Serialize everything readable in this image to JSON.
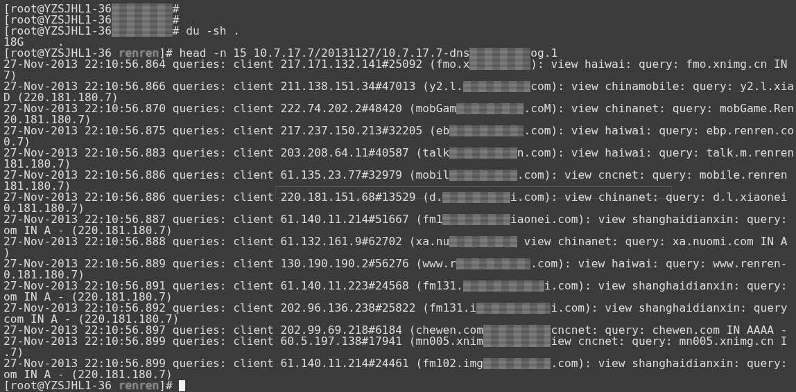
{
  "terminal": {
    "lines": [
      {
        "segments": [
          {
            "kind": "text",
            "text": "[root@YZSJHL1-36"
          },
          {
            "kind": "redacted"
          },
          {
            "kind": "text",
            "text": "#"
          }
        ]
      },
      {
        "segments": [
          {
            "kind": "text",
            "text": "[root@YZSJHL1-36"
          },
          {
            "kind": "redacted"
          },
          {
            "kind": "text",
            "text": "#"
          }
        ]
      },
      {
        "segments": [
          {
            "kind": "text",
            "text": "[root@YZSJHL1-36"
          },
          {
            "kind": "redacted"
          },
          {
            "kind": "text",
            "text": "# du -sh ."
          }
        ]
      },
      {
        "segments": [
          {
            "kind": "text",
            "text": "18G     ."
          }
        ]
      },
      {
        "segments": [
          {
            "kind": "text",
            "text": "[root@YZSJHL1-36 "
          },
          {
            "kind": "smudged",
            "text": "renren"
          },
          {
            "kind": "text",
            "text": "]# head -n 15 10.7.17.7/20131127/10.7.17.7-dns"
          },
          {
            "kind": "redacted"
          },
          {
            "kind": "text",
            "text": "og.1"
          }
        ]
      },
      {
        "segments": [
          {
            "kind": "text",
            "text": "27-Nov-2013 22:10:56.864 queries: client 217.171.132.141#25092 (fmo.x"
          },
          {
            "kind": "redacted"
          },
          {
            "kind": "text",
            "text": "): view haiwai: query: fmo.xnimg.cn IN"
          }
        ]
      },
      {
        "segments": [
          {
            "kind": "text",
            "text": "7)"
          }
        ]
      },
      {
        "segments": [
          {
            "kind": "text",
            "text": "27-Nov-2013 22:10:56.866 queries: client 211.138.151.34#47013 (y2.l."
          },
          {
            "kind": "redacted"
          },
          {
            "kind": "text",
            "text": "com): view chinamobile: query: y2.l.xia"
          }
        ]
      },
      {
        "segments": [
          {
            "kind": "text",
            "text": "D (220.181.180.7)"
          }
        ]
      },
      {
        "segments": [
          {
            "kind": "text",
            "text": "27-Nov-2013 22:10:56.870 queries: client 222.74.202.2#48420 (mobGam"
          },
          {
            "kind": "redacted"
          },
          {
            "kind": "text",
            "text": ".coM): view chinanet: query: mobGame.Ren"
          }
        ]
      },
      {
        "segments": [
          {
            "kind": "text",
            "text": "20.181.180.7)"
          }
        ]
      },
      {
        "segments": [
          {
            "kind": "text",
            "text": "27-Nov-2013 22:10:56.875 queries: client 217.237.150.213#32205 (eb"
          },
          {
            "kind": "redacted"
          },
          {
            "kind": "text",
            "text": ".com): view haiwai: query: ebp.renren.co"
          }
        ]
      },
      {
        "segments": [
          {
            "kind": "text",
            "text": "0.7)"
          }
        ]
      },
      {
        "segments": [
          {
            "kind": "text",
            "text": "27-Nov-2013 22:10:56.883 queries: client 203.208.64.11#40587 (talk"
          },
          {
            "kind": "redacted"
          },
          {
            "kind": "text",
            "text": "n.com): view haiwai: query: talk.m.renren"
          }
        ]
      },
      {
        "segments": [
          {
            "kind": "text",
            "text": "181.180.7)"
          }
        ]
      },
      {
        "segments": [
          {
            "kind": "text",
            "text": "27-Nov-2013 22:10:56.886 queries: client 61.135.23.77#32979 (mobil"
          },
          {
            "kind": "redacted"
          },
          {
            "kind": "text",
            "text": ".com): view cncnet: query: mobile.renren"
          }
        ]
      },
      {
        "segments": [
          {
            "kind": "text",
            "text": "181.180.7)"
          }
        ]
      },
      {
        "segments": [
          {
            "kind": "text",
            "text": "27-Nov-2013 22:10:56.886 queries: client 220.181.151.68#13529 (d."
          },
          {
            "kind": "redacted"
          },
          {
            "kind": "text",
            "text": "i.com): view chinanet: query: d.l.xiaonei"
          }
        ]
      },
      {
        "segments": [
          {
            "kind": "text",
            "text": "0.181.180.7)"
          }
        ]
      },
      {
        "segments": [
          {
            "kind": "text",
            "text": "27-Nov-2013 22:10:56.887 queries: client 61.140.11.214#51667 (fm1"
          },
          {
            "kind": "redacted"
          },
          {
            "kind": "text",
            "text": "iaonei.com): view shanghaidianxin: query:"
          }
        ]
      },
      {
        "segments": [
          {
            "kind": "text",
            "text": "om IN A - (220.181.180.7)"
          }
        ]
      },
      {
        "segments": [
          {
            "kind": "text",
            "text": "27-Nov-2013 22:10:56.888 queries: client 61.132.161.9#62702 (xa.nu"
          },
          {
            "kind": "redacted"
          },
          {
            "kind": "text",
            "text": " view chinanet: query: xa.nuomi.com IN A"
          }
        ]
      },
      {
        "segments": [
          {
            "kind": "text",
            "text": ")"
          }
        ]
      },
      {
        "segments": [
          {
            "kind": "text",
            "text": "27-Nov-2013 22:10:56.889 queries: client 130.190.190.2#56276 (www.r"
          },
          {
            "kind": "redacted"
          },
          {
            "kind": "text",
            "text": ".com): view haiwai: query: www.renren-"
          }
        ]
      },
      {
        "segments": [
          {
            "kind": "text",
            "text": "0.181.180.7)"
          }
        ]
      },
      {
        "segments": [
          {
            "kind": "text",
            "text": "27-Nov-2013 22:10:56.891 queries: client 61.140.11.223#24568 (fm131."
          },
          {
            "kind": "redacted"
          },
          {
            "kind": "text",
            "text": "i.com): view shanghaidianxin: query:"
          }
        ]
      },
      {
        "segments": [
          {
            "kind": "text",
            "text": "om IN A - (220.181.180.7)"
          }
        ]
      },
      {
        "segments": [
          {
            "kind": "text",
            "text": "27-Nov-2013 22:10:56.892 queries: client 202.96.136.238#25822 (fm131.i"
          },
          {
            "kind": "redacted"
          },
          {
            "kind": "text",
            "text": "i.com): view shanghaidianxin: query"
          }
        ]
      },
      {
        "segments": [
          {
            "kind": "text",
            "text": "com IN A - (220.181.180.7)"
          }
        ]
      },
      {
        "segments": [
          {
            "kind": "text",
            "text": "27-Nov-2013 22:10:56.897 queries: client 202.99.69.218#6184 (chewen.com"
          },
          {
            "kind": "redacted"
          },
          {
            "kind": "text",
            "text": "cncnet: query: chewen.com IN AAAA -"
          }
        ]
      },
      {
        "segments": [
          {
            "kind": "text",
            "text": "27-Nov-2013 22:10:56.899 queries: client 60.5.197.138#17941 (mn005.xnim"
          },
          {
            "kind": "redacted"
          },
          {
            "kind": "text",
            "text": "iew cncnet: query: mn005.xnimg.cn I"
          }
        ]
      },
      {
        "segments": [
          {
            "kind": "text",
            "text": ".7)"
          }
        ]
      },
      {
        "segments": [
          {
            "kind": "text",
            "text": "27-Nov-2013 22:10:56.899 queries: client 61.140.11.214#24461 (fm102.img"
          },
          {
            "kind": "redacted"
          },
          {
            "kind": "text",
            "text": ".com): view shanghaidianxin: query:"
          }
        ]
      },
      {
        "segments": [
          {
            "kind": "text",
            "text": "om IN A - (220.181.180.7)"
          }
        ]
      },
      {
        "segments": [
          {
            "kind": "text",
            "text": "[root@YZSJHL1-36 "
          },
          {
            "kind": "smudged",
            "text": "renren"
          },
          {
            "kind": "text",
            "text": "]#"
          }
        ],
        "cursor": true
      }
    ]
  }
}
